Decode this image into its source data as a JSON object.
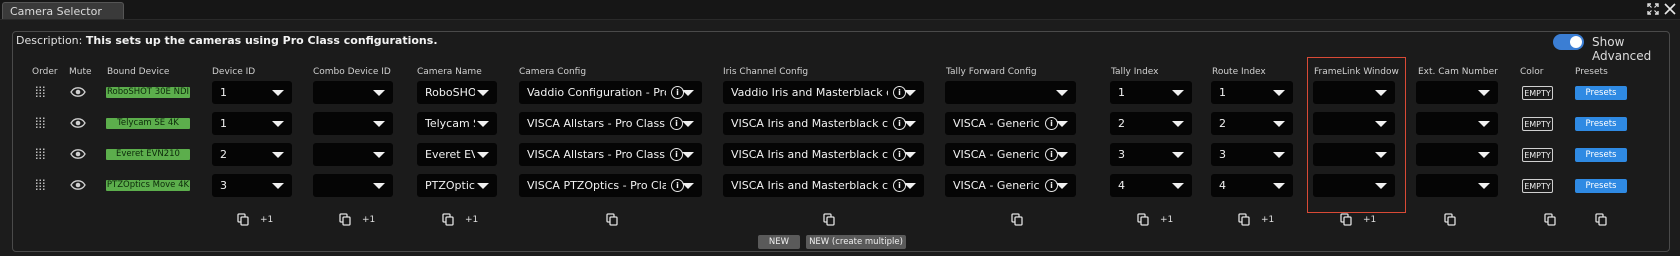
{
  "window": {
    "tab_title": "Camera Selector"
  },
  "description": {
    "label": "Description: ",
    "text": "This sets up the cameras using Pro Class configurations."
  },
  "toggle": {
    "label": "Show Advanced",
    "on": true
  },
  "headers": {
    "order": "Order",
    "mute": "Mute",
    "bound_device": "Bound Device",
    "device_id": "Device ID",
    "combo_device_id": "Combo Device ID",
    "camera_name": "Camera Name",
    "camera_config": "Camera Config",
    "iris_channel_config": "Iris Channel Config",
    "tally_forward_config": "Tally Forward Config",
    "tally_index": "Tally Index",
    "route_index": "Route Index",
    "framelink_window": "FrameLink Window",
    "ext_cam_number": "Ext. Cam Number",
    "color": "Color",
    "presets": "Presets"
  },
  "rows": [
    {
      "bound_device": "RoboSHOT 30E NDI",
      "device_id": "1",
      "combo_device_id": "",
      "camera_name": "RoboSHOT",
      "camera_config": "Vaddio Configuration - Pro Class",
      "iris_channel_config": "Vaddio Iris and Masterblack controls",
      "tally_forward_config": "",
      "tally_index": "1",
      "route_index": "1",
      "framelink_window": "",
      "ext_cam_number": "",
      "color": "EMPTY",
      "presets": "Presets"
    },
    {
      "bound_device": "Telycam SE 4K",
      "device_id": "1",
      "combo_device_id": "",
      "camera_name": "Telycam SE",
      "camera_config": "VISCA Allstars - Pro Class",
      "iris_channel_config": "VISCA Iris and Masterblack controls",
      "tally_forward_config": "VISCA - Generic - Tally",
      "tally_index": "2",
      "route_index": "2",
      "framelink_window": "",
      "ext_cam_number": "",
      "color": "EMPTY",
      "presets": "Presets"
    },
    {
      "bound_device": "Everet EVN210",
      "device_id": "2",
      "combo_device_id": "",
      "camera_name": "Everet EVN",
      "camera_config": "VISCA Allstars - Pro Class",
      "iris_channel_config": "VISCA Iris and Masterblack controls",
      "tally_forward_config": "VISCA - Generic - Tally",
      "tally_index": "3",
      "route_index": "3",
      "framelink_window": "",
      "ext_cam_number": "",
      "color": "EMPTY",
      "presets": "Presets"
    },
    {
      "bound_device": "PTZOptics Move 4K",
      "device_id": "3",
      "combo_device_id": "",
      "camera_name": "PTZOptics I",
      "camera_config": "VISCA PTZOptics - Pro Class",
      "iris_channel_config": "VISCA Iris and Masterblack controls",
      "tally_forward_config": "VISCA - Generic - Tally",
      "tally_index": "4",
      "route_index": "4",
      "framelink_window": "",
      "ext_cam_number": "",
      "color": "EMPTY",
      "presets": "Presets"
    }
  ],
  "footer": {
    "plus_one": "+1",
    "new_label": "NEW",
    "new_multiple_label": "NEW (create multiple)"
  },
  "colors": {
    "accent": "#2f8ae3",
    "device_badge": "#5cae4c",
    "highlight": "#d94a36"
  }
}
